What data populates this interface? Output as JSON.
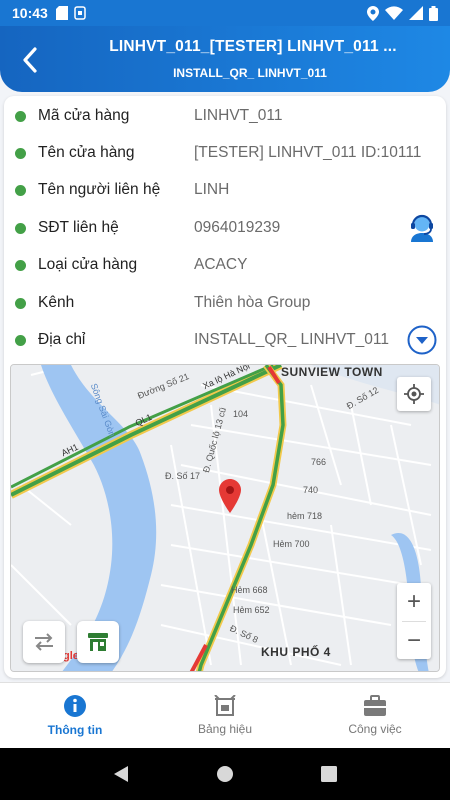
{
  "status_bar": {
    "time": "10:43",
    "icons_left": [
      "sd-card-icon",
      "sim-icon"
    ],
    "icons_right": [
      "location-icon",
      "wifi-icon",
      "signal-icon",
      "battery-icon"
    ]
  },
  "header": {
    "title": "LINHVT_011_[TESTER] LINHVT_011 ...",
    "subtitle": "INSTALL_QR_ LINHVT_011",
    "back_icon": "chevron-left-icon"
  },
  "info_rows": [
    {
      "label": "Mã cửa hàng",
      "value": "LINHVT_011"
    },
    {
      "label": "Tên cửa hàng",
      "value": "[TESTER] LINHVT_011 ID:10111"
    },
    {
      "label": "Tên người liên hệ",
      "value": "LINH"
    },
    {
      "label": "SĐT liên hệ",
      "value": "0964019239",
      "action_icon": "contact-support-icon"
    },
    {
      "label": "Loại cửa hàng",
      "value": "ACACY"
    },
    {
      "label": "Kênh",
      "value": "Thiên hòa Group"
    },
    {
      "label": "Địa chỉ",
      "value": "INSTALL_QR_ LINHVT_011",
      "action_icon": "expand-circle-icon"
    }
  ],
  "map": {
    "labels": {
      "sunview": "SUNVIEW TOWN",
      "road_21": "Đường Số 21",
      "xa_lo": "Xa lộ Hà Nội",
      "ql13": "Đ. Quốc lộ 13 cũ",
      "song": "Sông Sài Gòn",
      "so_12": "Đ. Số 12",
      "n104": "104",
      "n766": "766",
      "n740": "740",
      "so_17": "Đ. Số 17",
      "hem718": "hẻm 718",
      "hem700": "Hẻm 700",
      "hem668": "Hẻm 668",
      "hem652": "Hẻm 652",
      "so_8": "Đ. Số 8",
      "khupho": "KHU PHỐ 4",
      "ah1_a": "AH1",
      "ah1_b": "QL1",
      "google": "Google"
    },
    "controls": {
      "zoom_in": "+",
      "zoom_out": "−"
    }
  },
  "bottom_nav": [
    {
      "label": "Thông tin",
      "icon": "info-icon",
      "active": true
    },
    {
      "label": "Bảng hiệu",
      "icon": "signboard-icon",
      "active": false
    },
    {
      "label": "Công việc",
      "icon": "briefcase-icon",
      "active": false
    }
  ],
  "colors": {
    "primary": "#1976d2",
    "dot_green": "#43a047",
    "pin_red": "#e53935"
  }
}
